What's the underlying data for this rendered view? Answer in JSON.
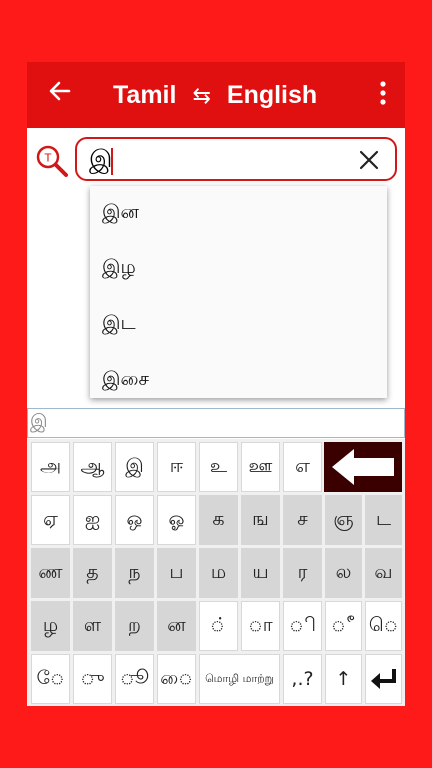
{
  "header": {
    "source_language": "Tamil",
    "target_language": "English",
    "swap_glyph": "⇆"
  },
  "search": {
    "value": "இ",
    "clear_glyph": "✕"
  },
  "suggestions": [
    "இன",
    "இழ",
    "இட",
    "இசை"
  ],
  "keyboard_input": "இ",
  "keyboard": {
    "rows": [
      [
        "அ",
        "ஆ",
        "இ",
        "ஈ",
        "உ",
        "ஊ",
        "எ"
      ],
      [
        "ஏ",
        "ஐ",
        "ஒ",
        "ஓ",
        "க",
        "ங",
        "ச",
        "ஞ",
        "ட"
      ],
      [
        "ண",
        "த",
        "ந",
        "ப",
        "ம",
        "ய",
        "ர",
        "ல",
        "வ"
      ],
      [
        "ழ",
        "ள",
        "ற",
        "ன",
        "◌்",
        "◌ா",
        "◌ி",
        "◌ீ",
        "◌ெ"
      ],
      [
        "◌ே",
        "◌ு",
        "◌ூ",
        "◌ை"
      ]
    ],
    "language_switch": "மொழி மாற்று",
    "punctuation": ",.?",
    "shift": "↑"
  }
}
